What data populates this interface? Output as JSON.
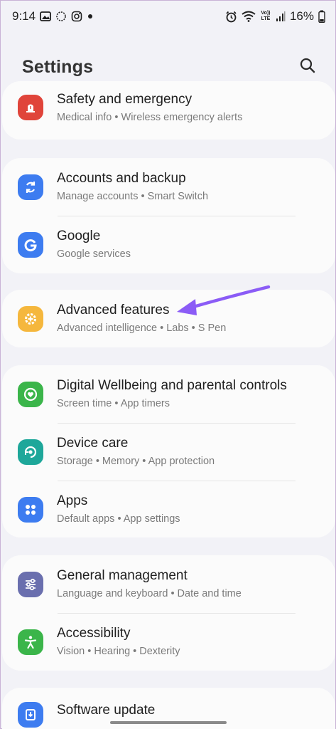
{
  "status_bar": {
    "time": "9:14",
    "battery": "16%",
    "left_icons": [
      "gallery-icon",
      "loading-icon",
      "instagram-icon",
      "dot-icon"
    ],
    "right_icons": [
      "alarm-icon",
      "wifi-icon",
      "volte-icon",
      "signal-icon",
      "battery-icon"
    ],
    "volte_label": "Vo))\nLTE"
  },
  "header": {
    "title": "Settings",
    "search_icon": "search-icon"
  },
  "groups": [
    {
      "items": [
        {
          "title": "Safety and emergency",
          "subtitle": "Medical info  •  Wireless emergency alerts",
          "icon": "siren-icon",
          "color": "#e0443a"
        }
      ]
    },
    {
      "items": [
        {
          "title": "Accounts and backup",
          "subtitle": "Manage accounts  •  Smart Switch",
          "icon": "sync-icon",
          "color": "#3d7cf0"
        },
        {
          "title": "Google",
          "subtitle": "Google services",
          "icon": "google-icon",
          "color": "#3d7cf0"
        }
      ]
    },
    {
      "items": [
        {
          "title": "Advanced features",
          "subtitle": "Advanced intelligence  •  Labs  •  S Pen",
          "icon": "gear-plus-icon",
          "color": "#f5b73d"
        }
      ]
    },
    {
      "items": [
        {
          "title": "Digital Wellbeing and parental controls",
          "subtitle": "Screen time  •  App timers",
          "icon": "heart-circle-icon",
          "color": "#3bb54a"
        },
        {
          "title": "Device care",
          "subtitle": "Storage  •  Memory  •  App protection",
          "icon": "device-care-icon",
          "color": "#1ea79a"
        },
        {
          "title": "Apps",
          "subtitle": "Default apps  •  App settings",
          "icon": "apps-grid-icon",
          "color": "#3d7cf0"
        }
      ]
    },
    {
      "items": [
        {
          "title": "General management",
          "subtitle": "Language and keyboard  •  Date and time",
          "icon": "sliders-icon",
          "color": "#6a6fae"
        },
        {
          "title": "Accessibility",
          "subtitle": "Vision  •  Hearing  •  Dexterity",
          "icon": "accessibility-icon",
          "color": "#3bb54a"
        }
      ]
    },
    {
      "items": [
        {
          "title": "Software update",
          "subtitle": "",
          "icon": "update-icon",
          "color": "#3d7cf0"
        }
      ]
    }
  ],
  "annotation": {
    "arrow_color": "#8b5cf6",
    "target": "Advanced features"
  },
  "colors": {
    "background": "#f2f2f7",
    "card": "#fbfbfb",
    "accent_arrow": "#8b5cf6"
  }
}
